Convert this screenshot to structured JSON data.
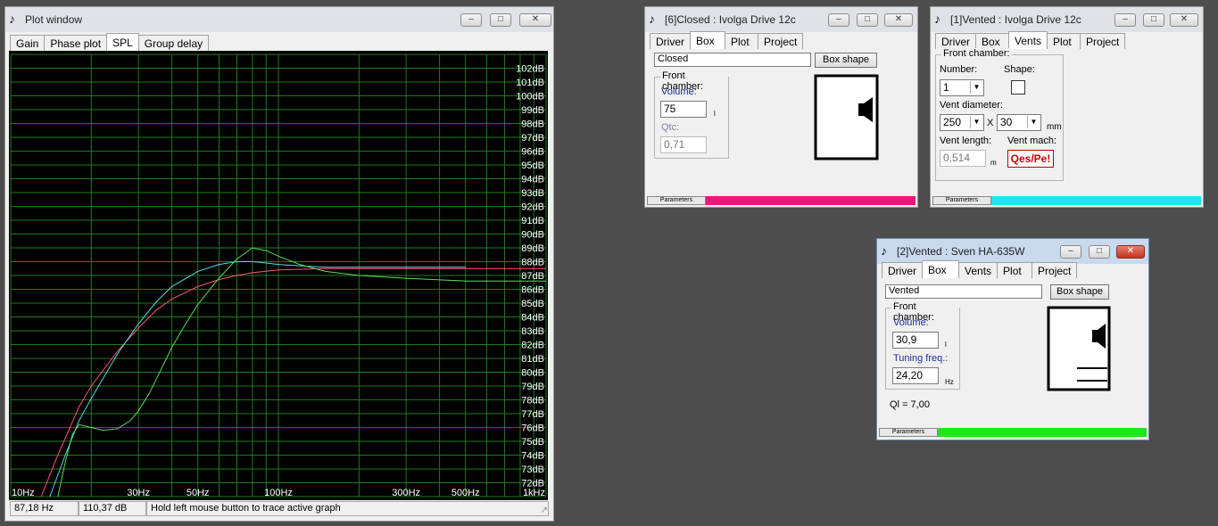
{
  "plot_window": {
    "title": "Plot window",
    "tabs": [
      "Gain",
      "Phase plot",
      "SPL",
      "Group delay"
    ],
    "active_tab": "SPL",
    "status": {
      "freq": "87,18 Hz",
      "level": "110,37 dB",
      "hint": "Hold left mouse button to trace active graph"
    }
  },
  "chart_data": {
    "type": "line",
    "xscale": "log",
    "xlim": [
      10,
      1000
    ],
    "ylim": [
      71,
      103
    ],
    "x_tick_labels": [
      "10Hz",
      "30Hz",
      "50Hz",
      "100Hz",
      "300Hz",
      "500Hz",
      "1kHz"
    ],
    "x_tick_values": [
      10,
      30,
      50,
      100,
      300,
      500,
      1000
    ],
    "y_tick_labels": [
      "102dB",
      "101dB",
      "100dB",
      "99dB",
      "98dB",
      "97dB",
      "96dB",
      "95dB",
      "94dB",
      "93dB",
      "92dB",
      "91dB",
      "90dB",
      "89dB",
      "88dB",
      "87dB",
      "86dB",
      "85dB",
      "84dB",
      "83dB",
      "82dB",
      "81dB",
      "80dB",
      "79dB",
      "78dB",
      "77dB",
      "76dB",
      "75dB",
      "74dB",
      "73dB",
      "72dB"
    ],
    "grid": true,
    "background": "#000000",
    "gridcolor": "#1f7a1f",
    "series": [
      {
        "color": "#ff5577",
        "x": [
          13,
          15,
          18,
          20,
          25,
          30,
          35,
          40,
          50,
          60,
          70,
          80,
          100,
          150,
          200,
          300,
          500,
          1000
        ],
        "y": [
          71,
          74,
          77.5,
          79,
          81.5,
          83.2,
          84.5,
          85.3,
          86.2,
          86.7,
          87,
          87.2,
          87.4,
          87.5,
          87.5,
          87.5,
          87.5,
          87.5
        ]
      },
      {
        "color": "#55dde6",
        "x": [
          14,
          16,
          18,
          20,
          25,
          30,
          35,
          40,
          50,
          60,
          70,
          80,
          90,
          100,
          120,
          150,
          200,
          300,
          500
        ],
        "y": [
          71,
          74,
          76.5,
          78.1,
          81.3,
          83.5,
          85.1,
          86.2,
          87.3,
          87.8,
          88,
          88,
          87.9,
          87.8,
          87.7,
          87.6,
          87.6,
          87.6,
          87.6
        ]
      },
      {
        "color": "#55e055",
        "x": [
          15,
          16,
          17,
          18,
          20,
          22,
          25,
          28,
          30,
          33,
          35,
          40,
          45,
          50,
          60,
          70,
          80,
          90,
          100,
          120,
          150,
          200,
          300,
          500,
          1000
        ],
        "y": [
          71,
          73.5,
          75.5,
          76.2,
          76,
          75.8,
          75.9,
          76.5,
          77.2,
          78.5,
          79.5,
          81.8,
          83.5,
          84.9,
          86.8,
          88.2,
          89,
          88.8,
          88.4,
          87.8,
          87.3,
          87,
          86.8,
          86.6,
          86.6
        ]
      }
    ]
  },
  "win6": {
    "title": "[6]Closed : Ivolga Drive 12c",
    "tabs": [
      "Driver",
      "Box",
      "Plot",
      "Project"
    ],
    "active_tab": "Box",
    "box_type": "Closed",
    "box_shape_button": "Box shape",
    "front_chamber": "Front chamber:",
    "volume_label": "Volume:",
    "volume_value": "75",
    "volume_unit": "l",
    "qtc_label": "Qtc:",
    "qtc_value": "0,71",
    "parameters_label": "Parameters",
    "accent_color": "#f0157a"
  },
  "win1": {
    "title": "[1]Vented : Ivolga Drive 12c",
    "tabs": [
      "Driver",
      "Box",
      "Vents",
      "Plot",
      "Project"
    ],
    "active_tab": "Vents",
    "front_chamber": "Front chamber:",
    "number_label": "Number:",
    "number_value": "1",
    "shape_label": "Shape:",
    "vent_diameter_label": "Vent diameter:",
    "vent_d1": "250",
    "vent_x": "X",
    "vent_d2": "30",
    "vent_unit": "mm",
    "vent_length_label": "Vent length:",
    "vent_length_value": "0,514",
    "vent_length_unit": "m",
    "vent_mach_label": "Vent mach:",
    "vent_mach_button": "Qes/Pe!",
    "parameters_label": "Parameters",
    "accent_color": "#1ee6f0"
  },
  "win2": {
    "title": "[2]Vented : Sven HA-635W",
    "tabs": [
      "Driver",
      "Box",
      "Vents",
      "Plot",
      "Project"
    ],
    "active_tab": "Box",
    "box_type": "Vented",
    "box_shape_button": "Box shape",
    "front_chamber": "Front chamber:",
    "volume_label": "Volume:",
    "volume_value": "30,9",
    "volume_unit": "l",
    "tuning_label": "Tuning freq.:",
    "tuning_value": "24,20",
    "tuning_unit": "Hz",
    "ql_text": "Ql = 7,00",
    "parameters_label": "Parameters",
    "accent_color": "#1ee61e"
  }
}
